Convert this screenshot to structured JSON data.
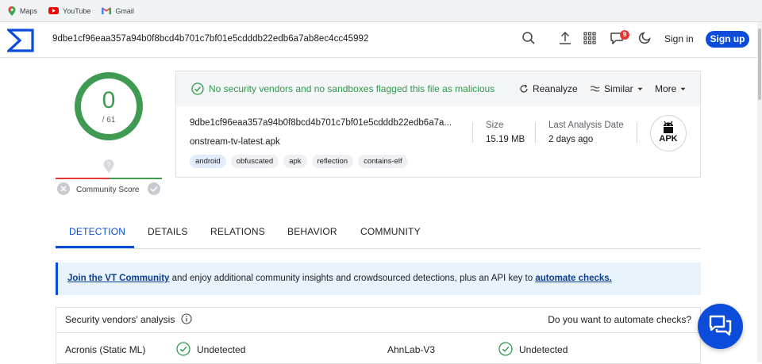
{
  "bookmarks": [
    {
      "label": "Maps",
      "icon": "maps-pin-icon"
    },
    {
      "label": "YouTube",
      "icon": "youtube-icon"
    },
    {
      "label": "Gmail",
      "icon": "gmail-icon"
    }
  ],
  "header": {
    "search_value": "9dbe1cf96eaa357a94b0f8bcd4b701c7bf01e5cdddb22edb6a7ab8ec4cc45992",
    "notification_count": "9",
    "sign_in": "Sign in",
    "sign_up": "Sign up"
  },
  "score": {
    "detections": "0",
    "total": "/ 61",
    "community_label": "Community Score"
  },
  "card": {
    "status": "No security vendors and no sandboxes flagged this file as malicious",
    "reanalyze": "Reanalyze",
    "similar": "Similar",
    "more": "More",
    "hash": "9dbe1cf96eaa357a94b0f8bcd4b701c7bf01e5cdddb22edb6a7a...",
    "filename": "onstream-tv-latest.apk",
    "tags": [
      "android",
      "obfuscated",
      "apk",
      "reflection",
      "contains-elf"
    ],
    "size_label": "Size",
    "size_value": "15.19 MB",
    "date_label": "Last Analysis Date",
    "date_value": "2 days ago",
    "file_type": "APK"
  },
  "tabs": [
    "DETECTION",
    "DETAILS",
    "RELATIONS",
    "BEHAVIOR",
    "COMMUNITY"
  ],
  "banner": {
    "link1": "Join the VT Community",
    "middle": " and enjoy additional community insights and crowdsourced detections, plus an API key to ",
    "link2": "automate checks."
  },
  "vendors": {
    "title": "Security vendors' analysis",
    "automate_prompt": "Do you want to automate checks?",
    "rows": [
      {
        "name": "Acronis (Static ML)",
        "result": "Undetected"
      },
      {
        "name": "AhnLab-V3",
        "result": "Undetected"
      }
    ]
  },
  "colors": {
    "brand_blue": "#0b4dda",
    "clean_green": "#3f9b52",
    "alert_red": "#e53935"
  }
}
